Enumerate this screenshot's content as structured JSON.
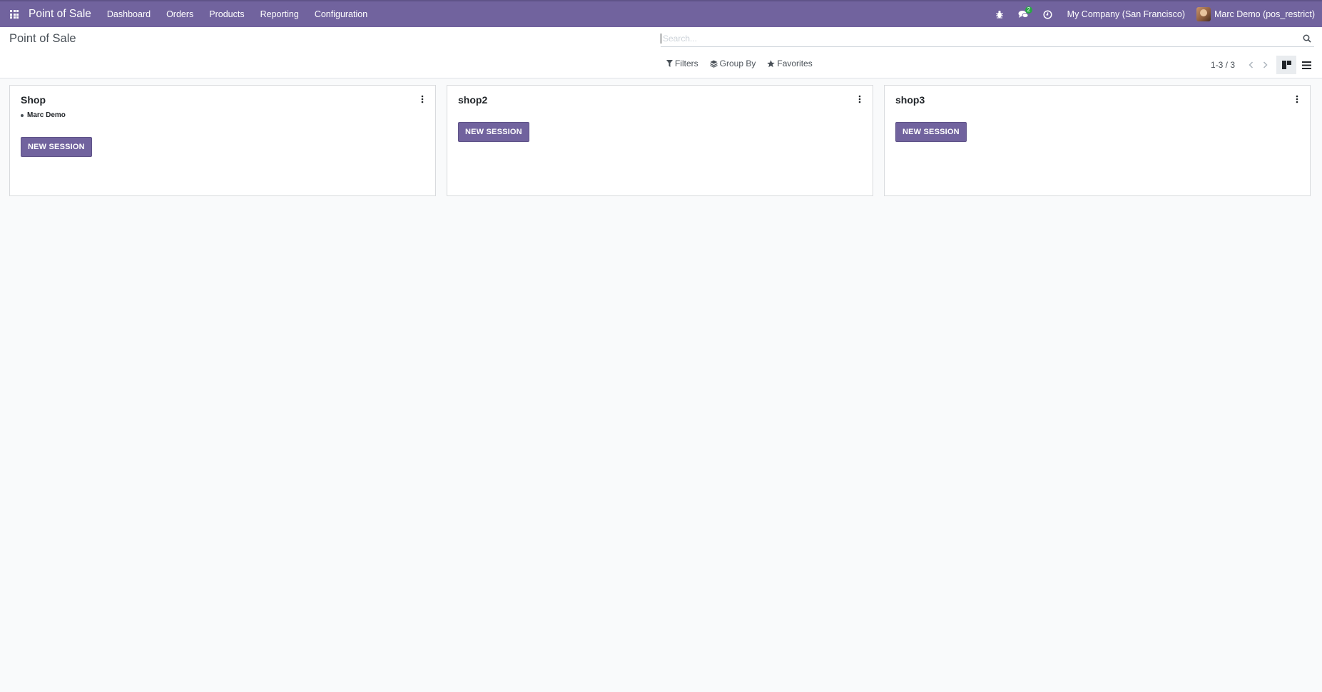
{
  "navbar": {
    "brand": "Point of Sale",
    "menu": [
      "Dashboard",
      "Orders",
      "Products",
      "Reporting",
      "Configuration"
    ],
    "chat_badge": "2",
    "company": "My Company (San Francisco)",
    "user": "Marc Demo (pos_restrict)"
  },
  "control_panel": {
    "title": "Point of Sale",
    "search_placeholder": "Search...",
    "filters_label": "Filters",
    "group_by_label": "Group By",
    "favorites_label": "Favorites",
    "pager": "1-3 / 3"
  },
  "cards": [
    {
      "title": "Shop",
      "user": "Marc Demo",
      "button": "NEW SESSION"
    },
    {
      "title": "shop2",
      "user": "",
      "button": "NEW SESSION"
    },
    {
      "title": "shop3",
      "user": "",
      "button": "NEW SESSION"
    }
  ],
  "colors": {
    "brand": "#71639e",
    "badge": "#28a745"
  }
}
